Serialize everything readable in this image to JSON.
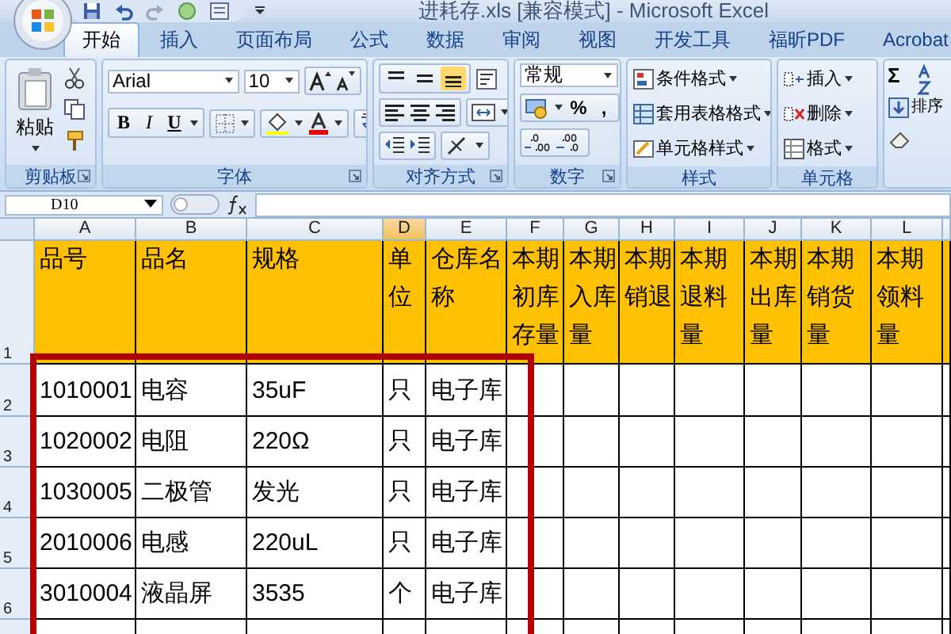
{
  "window": {
    "title": "进耗存.xls  [兼容模式] - Microsoft Excel"
  },
  "tabs": [
    {
      "label": "开始",
      "selected": true
    },
    {
      "label": "插入",
      "selected": false
    },
    {
      "label": "页面布局",
      "selected": false
    },
    {
      "label": "公式",
      "selected": false
    },
    {
      "label": "数据",
      "selected": false
    },
    {
      "label": "审阅",
      "selected": false
    },
    {
      "label": "视图",
      "selected": false
    },
    {
      "label": "开发工具",
      "selected": false
    },
    {
      "label": "福昕PDF",
      "selected": false
    },
    {
      "label": "Acrobat",
      "selected": false
    }
  ],
  "ribbon": {
    "groups": [
      {
        "kind": "clipboard",
        "label": "剪贴板",
        "paste": "粘贴"
      },
      {
        "kind": "font",
        "label": "字体",
        "font_name": "Arial",
        "font_size": "10",
        "style_buttons": [
          "B",
          "I",
          "U"
        ]
      },
      {
        "kind": "alignment",
        "label": "对齐方式",
        "vertical_align": [
          {
            "selected": false
          },
          {
            "selected": false
          },
          {
            "selected": true
          }
        ]
      },
      {
        "kind": "number",
        "label": "数字",
        "format": "常规",
        "symbols": [
          "%",
          ","
        ]
      },
      {
        "kind": "styles",
        "label": "样式",
        "items": [
          "条件格式",
          "套用表格格式",
          "单元格样式"
        ]
      },
      {
        "kind": "cells",
        "label": "单元格",
        "items": [
          "插入",
          "删除",
          "格式"
        ]
      },
      {
        "kind": "editing",
        "sum": "Σ",
        "sort": "排序"
      }
    ]
  },
  "formula_bar": {
    "name_box": "D10"
  },
  "sheet": {
    "columns": [
      {
        "label": "A",
        "selected": false
      },
      {
        "label": "B",
        "selected": false
      },
      {
        "label": "C",
        "selected": false
      },
      {
        "label": "D",
        "selected": true
      },
      {
        "label": "E",
        "selected": false
      },
      {
        "label": "F",
        "selected": false
      },
      {
        "label": "G",
        "selected": false
      },
      {
        "label": "H",
        "selected": false
      },
      {
        "label": "I",
        "selected": false
      },
      {
        "label": "J",
        "selected": false
      },
      {
        "label": "K",
        "selected": false
      },
      {
        "label": "L",
        "selected": false
      }
    ],
    "header_row": {
      "number": "1",
      "cells": [
        "品号",
        "品名",
        "规格",
        "单位",
        "仓库名称",
        "本期初库存量",
        "本期入库量",
        "本期销退",
        "本期退料量",
        "本期出库量",
        "本期销货量",
        "本期领料量"
      ]
    },
    "rows": [
      {
        "number": "2",
        "cells": [
          "1010001",
          "电容",
          "35uF",
          "只",
          "电子库"
        ]
      },
      {
        "number": "3",
        "cells": [
          "1020002",
          "电阻",
          "220Ω",
          "只",
          "电子库"
        ]
      },
      {
        "number": "4",
        "cells": [
          "1030005",
          "二极管",
          "发光",
          "只",
          "电子库"
        ]
      },
      {
        "number": "5",
        "cells": [
          "2010006",
          "电感",
          "220uL",
          "只",
          "电子库"
        ]
      },
      {
        "number": "6",
        "cells": [
          "3010004",
          "液晶屏",
          "3535",
          "个",
          "电子库"
        ]
      }
    ]
  }
}
